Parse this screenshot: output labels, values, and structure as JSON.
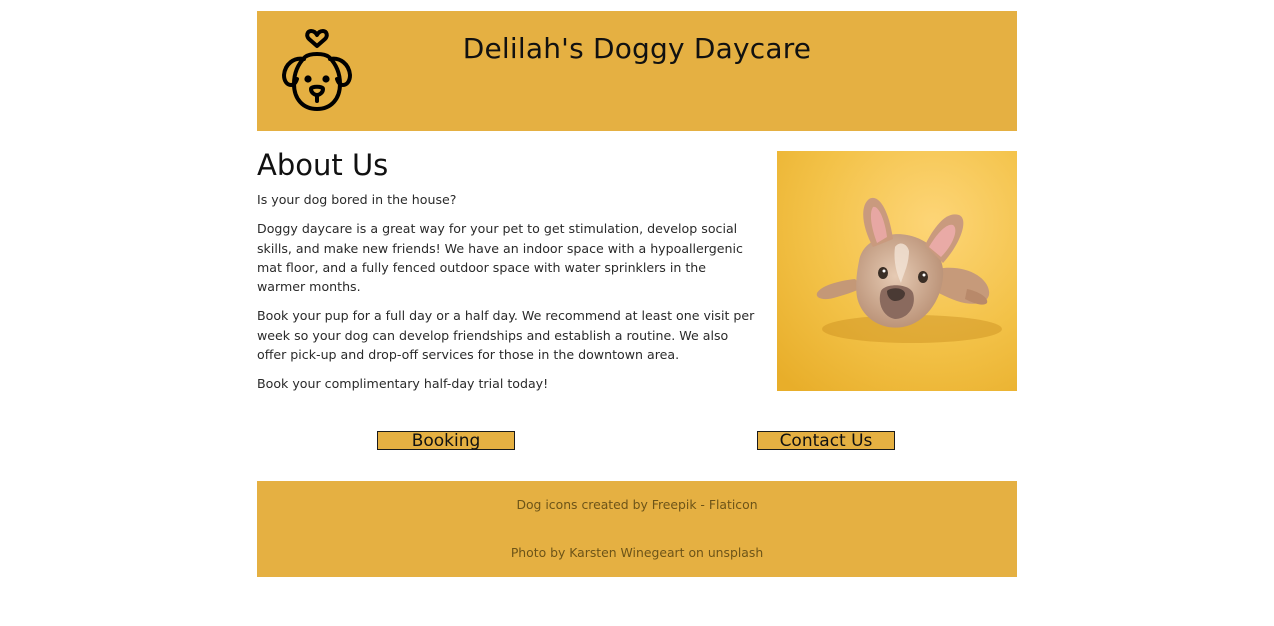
{
  "header": {
    "title": "Delilah's Doggy Daycare",
    "logo_icon": "dog-heart-icon"
  },
  "about": {
    "heading": "About Us",
    "paragraphs": [
      "Is your dog bored in the house?",
      "Doggy daycare is a great way for your pet to get stimulation, develop social skills, and make new friends! We have an indoor space with a hypoallergenic mat floor, and a fully fenced outdoor space with water sprinklers in the warmer months.",
      "Book your pup for a full day or a half day. We recommend at least one visit per week so your dog can develop friendships and establish a routine. We also offer pick-up and drop-off services for those in the downtown area.",
      "Book your complimentary half-day trial today!"
    ]
  },
  "buttons": {
    "booking": "Booking",
    "contact": "Contact Us"
  },
  "footer": {
    "credit_1_prefix": "Dog icons created by ",
    "credit_1_link": "Freepik - Flaticon",
    "credit_2_prefix": "Photo by ",
    "credit_2_author": "Karsten Winegeart",
    "credit_2_middle": " on ",
    "credit_2_link": "unsplash"
  },
  "colors": {
    "accent": "#e5b042",
    "photo_background": "#f1bf3e"
  }
}
